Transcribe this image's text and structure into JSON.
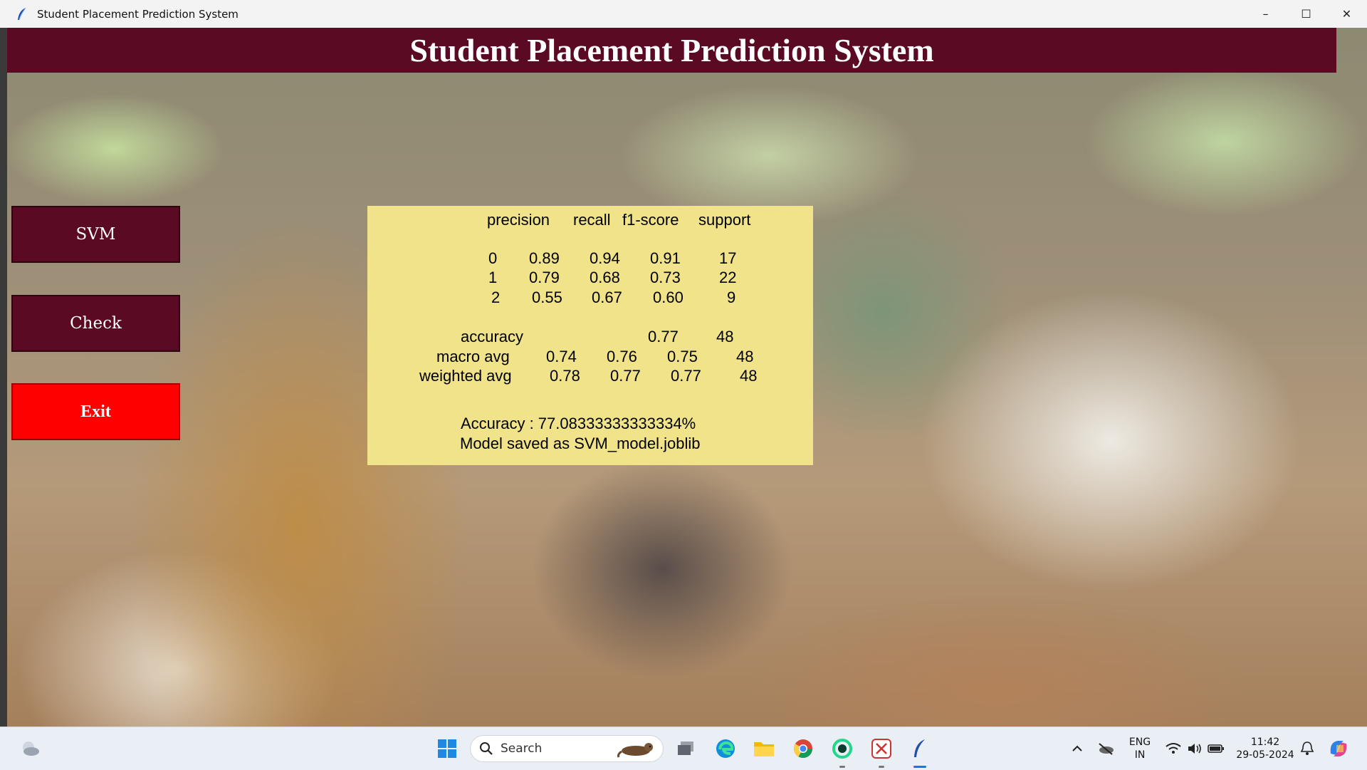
{
  "window": {
    "title": "Student Placement Prediction System",
    "controls": {
      "minimize": "–",
      "maximize": "☐",
      "close": "✕"
    }
  },
  "header": {
    "title": "Student Placement Prediction System"
  },
  "sidebar": {
    "buttons": [
      {
        "label": "SVM"
      },
      {
        "label": "Check"
      },
      {
        "label": "Exit"
      }
    ]
  },
  "report": {
    "headers": [
      "precision",
      "recall",
      "f1-score",
      "support"
    ],
    "rows": [
      {
        "label": "0",
        "precision": "0.89",
        "recall": "0.94",
        "f1": "0.91",
        "support": "17"
      },
      {
        "label": "1",
        "precision": "0.79",
        "recall": "0.68",
        "f1": "0.73",
        "support": "22"
      },
      {
        "label": "2",
        "precision": "0.55",
        "recall": "0.67",
        "f1": "0.60",
        "support": "9"
      }
    ],
    "accuracy": {
      "label": "accuracy",
      "f1": "0.77",
      "support": "48"
    },
    "macro": {
      "label": "macro avg",
      "precision": "0.74",
      "recall": "0.76",
      "f1": "0.75",
      "support": "48"
    },
    "weighted": {
      "label": "weighted avg",
      "precision": "0.78",
      "recall": "0.77",
      "f1": "0.77",
      "support": "48"
    },
    "accuracy_line": "Accuracy : 77.08333333333334%",
    "model_line": "Model saved as SVM_model.joblib"
  },
  "taskbar": {
    "search_placeholder": "Search",
    "language": "ENG",
    "region": "IN",
    "time": "11:42",
    "date": "29-05-2024"
  },
  "colors": {
    "header_bg": "#5a0a22",
    "exit_bg": "#ff0000",
    "panel_bg": "#f0e38a"
  }
}
